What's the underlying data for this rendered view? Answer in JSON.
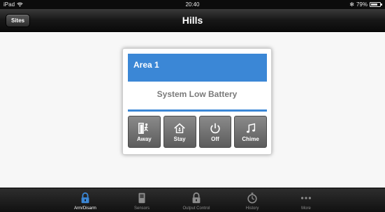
{
  "status_bar": {
    "device": "iPad",
    "time": "20:40",
    "battery": "79%",
    "battery_level": 0.79
  },
  "nav": {
    "title": "Hills",
    "back_label": "Sites"
  },
  "area": {
    "name": "Area 1",
    "status": "System Low Battery",
    "buttons": [
      {
        "label": "Away",
        "icon": "away-icon"
      },
      {
        "label": "Stay",
        "icon": "stay-icon"
      },
      {
        "label": "Off",
        "icon": "power-icon"
      },
      {
        "label": "Chime",
        "icon": "chime-icon"
      }
    ]
  },
  "tabs": [
    {
      "label": "Arm/Disarm",
      "icon": "lock-icon",
      "active": true
    },
    {
      "label": "Sensors",
      "icon": "sensor-icon",
      "active": false
    },
    {
      "label": "Output Control",
      "icon": "lock-icon",
      "active": false
    },
    {
      "label": "History",
      "icon": "stopwatch-icon",
      "active": false
    },
    {
      "label": "More",
      "icon": "more-icon",
      "active": false
    }
  ],
  "colors": {
    "accent": "#3b87d6",
    "bar": "#111111"
  }
}
